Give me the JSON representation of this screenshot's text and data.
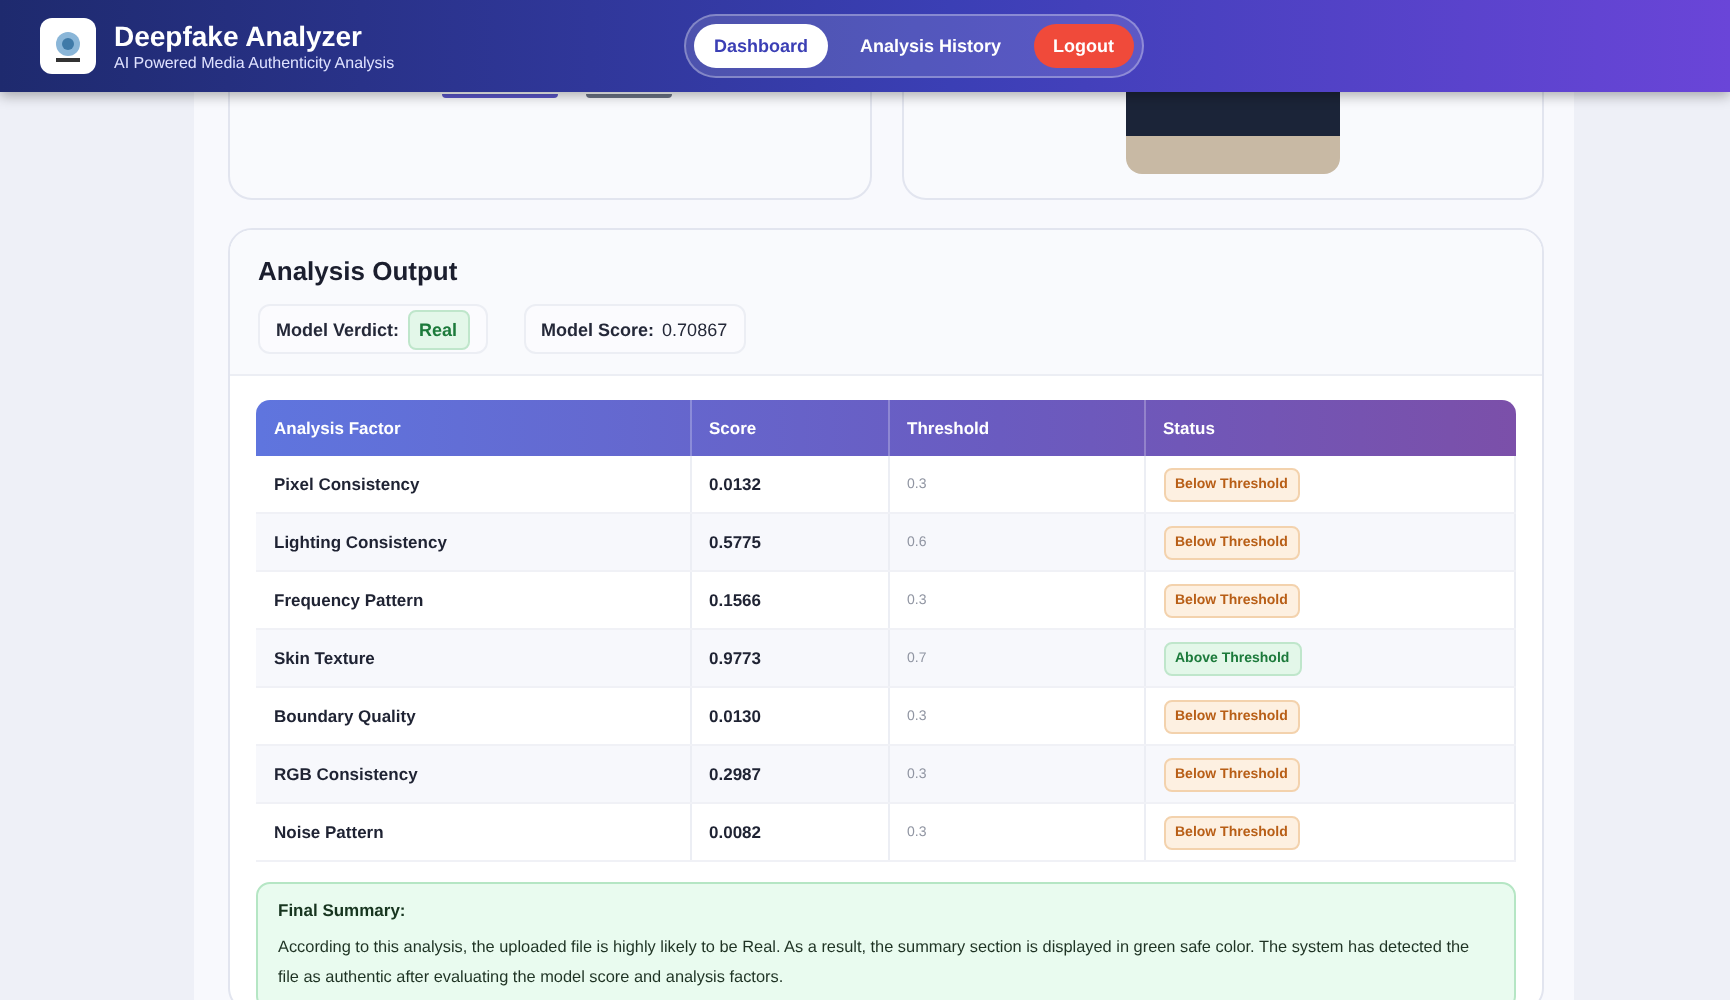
{
  "header": {
    "title": "Deepfake Analyzer",
    "subtitle": "AI Powered Media Authenticity Analysis",
    "nav": [
      {
        "label": "Dashboard",
        "kind": "link",
        "selected": true
      },
      {
        "label": "Analysis History",
        "kind": "link",
        "selected": false
      },
      {
        "label": "Logout",
        "kind": "danger",
        "selected": false
      }
    ]
  },
  "analysis": {
    "title": "Analysis Output",
    "verdict_label": "Model Verdict:",
    "verdict": "Real",
    "score_label": "Model Score:",
    "score": "0.70867",
    "table": {
      "columns": [
        "Analysis Factor",
        "Score",
        "Threshold",
        "Status"
      ],
      "rows": [
        {
          "factor": "Pixel Consistency",
          "score": "0.0132",
          "threshold": "0.3",
          "status": "Below Threshold",
          "kind": "below"
        },
        {
          "factor": "Lighting Consistency",
          "score": "0.5775",
          "threshold": "0.6",
          "status": "Below Threshold",
          "kind": "below"
        },
        {
          "factor": "Frequency Pattern",
          "score": "0.1566",
          "threshold": "0.3",
          "status": "Below Threshold",
          "kind": "below"
        },
        {
          "factor": "Skin Texture",
          "score": "0.9773",
          "threshold": "0.7",
          "status": "Above Threshold",
          "kind": "above"
        },
        {
          "factor": "Boundary Quality",
          "score": "0.0130",
          "threshold": "0.3",
          "status": "Below Threshold",
          "kind": "below"
        },
        {
          "factor": "RGB Consistency",
          "score": "0.2987",
          "threshold": "0.3",
          "status": "Below Threshold",
          "kind": "below"
        },
        {
          "factor": "Noise Pattern",
          "score": "0.0082",
          "threshold": "0.3",
          "status": "Below Threshold",
          "kind": "below"
        }
      ]
    },
    "summary": {
      "title": "Final Summary:",
      "text": "According to this analysis, the uploaded file is highly likely to be Real. As a result, the summary section is displayed in green safe color. The system has detected the file as authentic after evaluating the model score and analysis factors."
    }
  }
}
